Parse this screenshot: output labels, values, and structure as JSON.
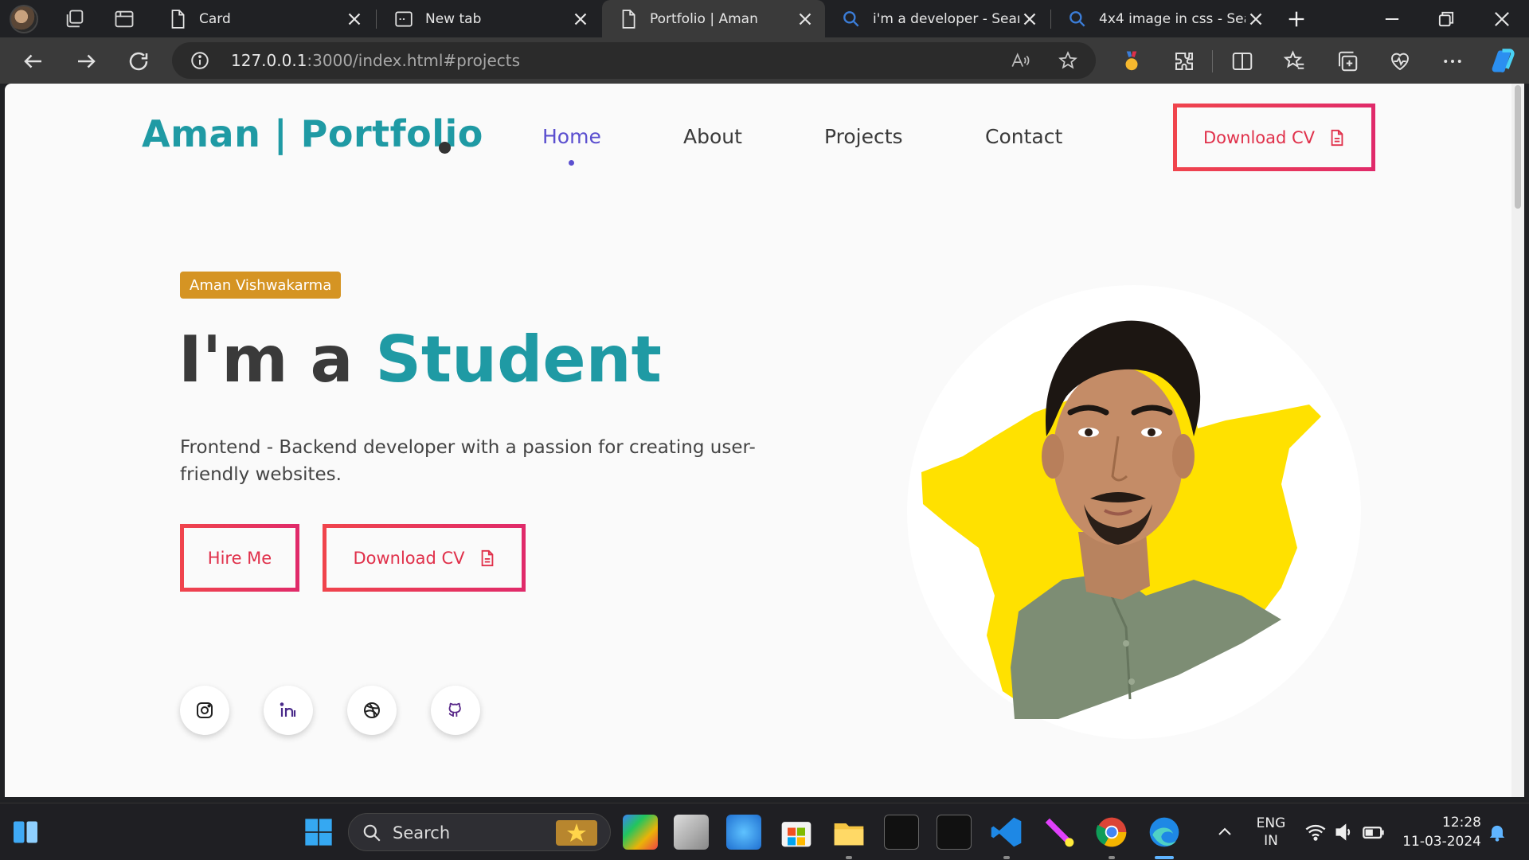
{
  "tabs": [
    {
      "title": "Card",
      "active": false
    },
    {
      "title": "New tab",
      "active": false
    },
    {
      "title": "Portfolio | Aman",
      "active": true
    },
    {
      "title": "i'm a developer - Searc",
      "active": false
    },
    {
      "title": "4x4 image in css - Sear",
      "active": false
    }
  ],
  "address_bar": {
    "host": "127.0.0.1",
    "rest": ":3000/index.html#projects"
  },
  "site": {
    "logo": "Aman | Portfolio",
    "nav": [
      "Home",
      "About",
      "Projects",
      "Contact"
    ],
    "header_cta": "Download CV",
    "name_badge": "Aman Vishwakarma",
    "headline_prefix": "I'm a",
    "headline_role": "Student",
    "description": "Frontend - Backend developer with a passion for creating user-friendly websites.",
    "hire_button": "Hire Me",
    "download_button": "Download CV",
    "socials": [
      "instagram-icon",
      "linkedin-icon",
      "dribbble-icon",
      "github-icon"
    ]
  },
  "taskbar": {
    "search_label": "Search",
    "language": "ENG",
    "region": "IN",
    "time": "12:28",
    "date": "11-03-2024"
  },
  "colors": {
    "accent_teal": "#1f9aa4",
    "nav_active": "#5b4fcf",
    "cta_red": "#e0304a",
    "badge": "#d59423",
    "blob_yellow": "#ffe100"
  }
}
